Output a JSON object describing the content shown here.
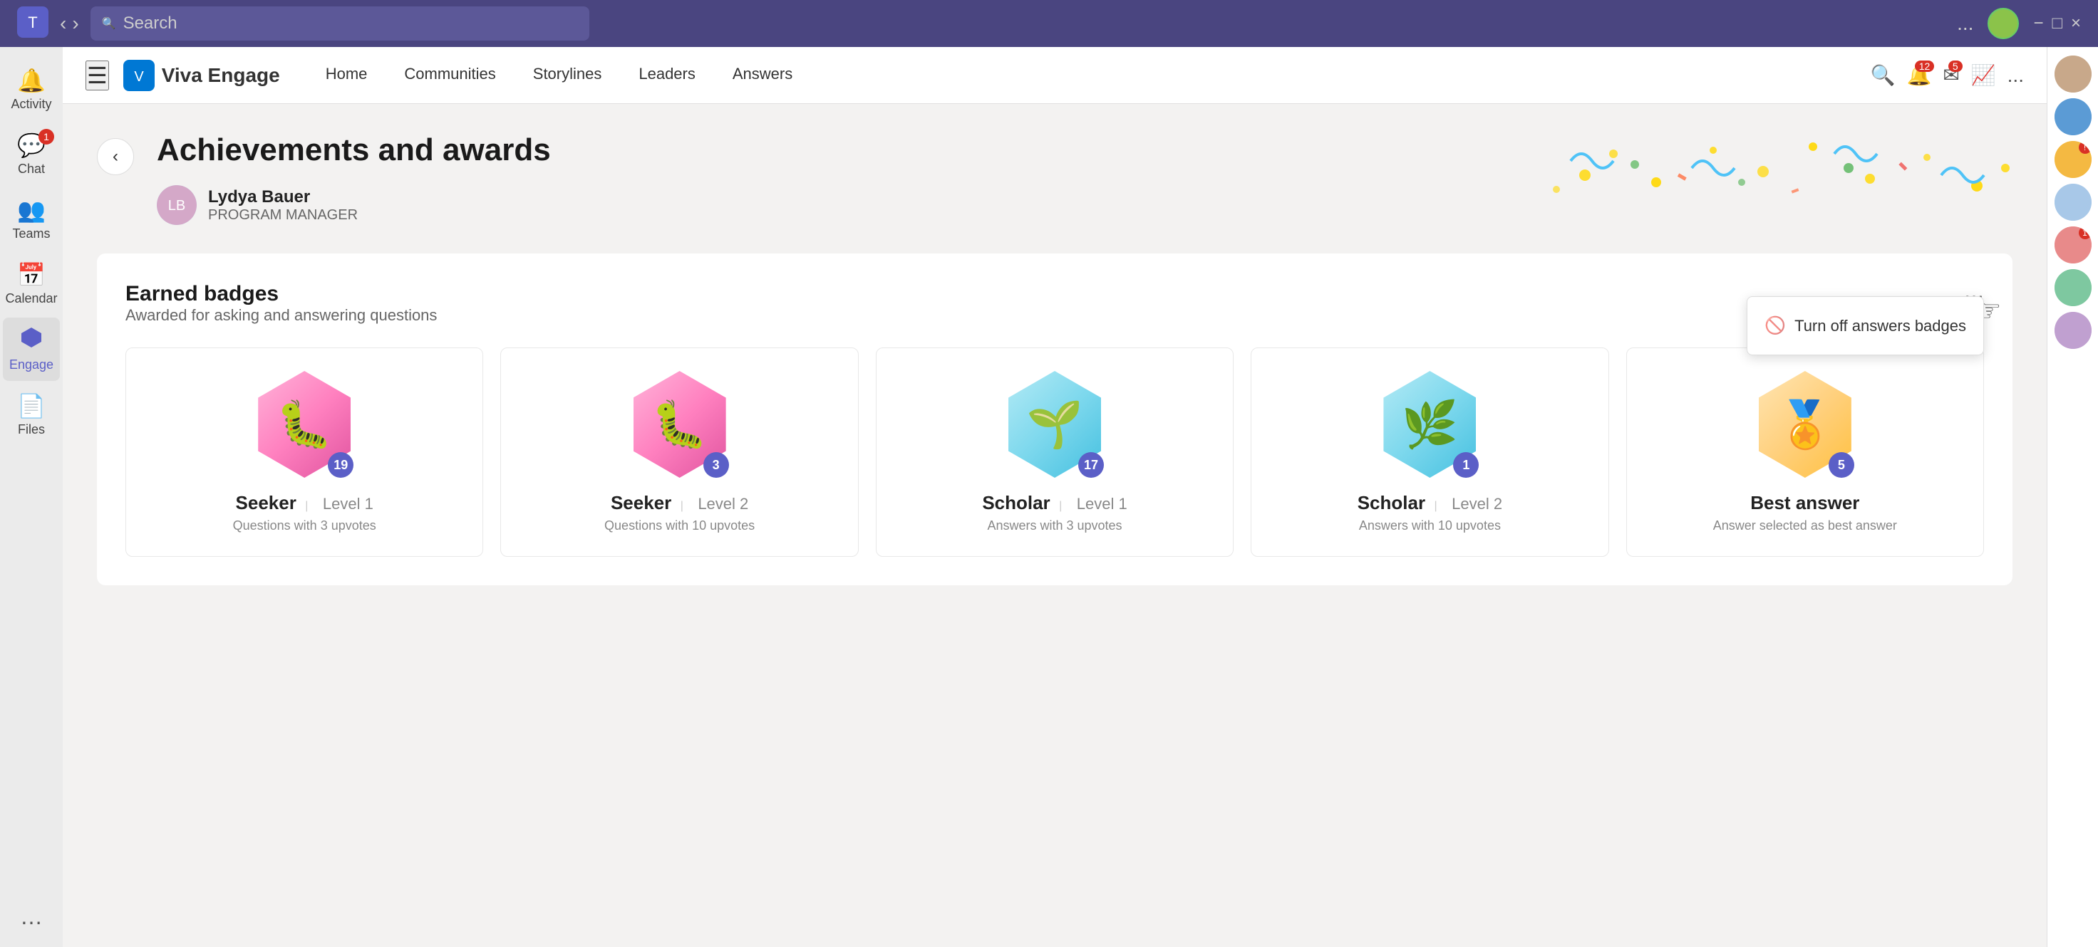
{
  "titlebar": {
    "search_placeholder": "Search",
    "more_label": "..."
  },
  "sidebar": {
    "items": [
      {
        "label": "Activity",
        "icon": "🔔",
        "badge": null,
        "active": false
      },
      {
        "label": "Chat",
        "icon": "💬",
        "badge": "1",
        "active": false
      },
      {
        "label": "Teams",
        "icon": "👥",
        "badge": null,
        "active": false
      },
      {
        "label": "Calendar",
        "icon": "📅",
        "badge": null,
        "active": false
      },
      {
        "label": "Engage",
        "icon": "◆",
        "badge": null,
        "active": true
      },
      {
        "label": "Files",
        "icon": "📄",
        "badge": null,
        "active": false
      }
    ],
    "more_label": "..."
  },
  "engage_nav": {
    "title": "Viva Engage",
    "links": [
      {
        "label": "Home"
      },
      {
        "label": "Communities"
      },
      {
        "label": "Storylines"
      },
      {
        "label": "Leaders"
      },
      {
        "label": "Answers"
      }
    ],
    "actions": {
      "search_icon": "🔍",
      "bell_icon": "🔔",
      "bell_badge": "12",
      "message_icon": "✉",
      "message_badge": "5",
      "chart_icon": "📈",
      "more_icon": "..."
    }
  },
  "page": {
    "back_icon": "‹",
    "title": "Achievements and awards",
    "user": {
      "name": "Lydya Bauer",
      "role": "PROGRAM MANAGER"
    }
  },
  "badges_section": {
    "title": "Earned badges",
    "subtitle": "Awarded for asking and answering questions",
    "more_icon": "⋯",
    "badges": [
      {
        "name": "Seeker",
        "level": "Level 1",
        "desc": "Questions with 3 upvotes",
        "count": "19",
        "color_class": "seeker1-bg",
        "emoji": "🐛"
      },
      {
        "name": "Seeker",
        "level": "Level 2",
        "desc": "Questions with 10 upvotes",
        "count": "3",
        "color_class": "seeker2-bg",
        "emoji": "🐛"
      },
      {
        "name": "Scholar",
        "level": "Level 1",
        "desc": "Answers with 3 upvotes",
        "count": "17",
        "color_class": "scholar1-bg",
        "emoji": "🌱"
      },
      {
        "name": "Scholar",
        "level": "Level 2",
        "desc": "Answers with 10 upvotes",
        "count": "1",
        "color_class": "scholar2-bg",
        "emoji": "🌿"
      },
      {
        "name": "Best answer",
        "level": "",
        "desc": "Answer selected as best answer",
        "count": "5",
        "color_class": "best-bg",
        "emoji": "🏅"
      }
    ]
  },
  "dropdown": {
    "items": [
      {
        "label": "Turn off answers badges",
        "icon": "🚫"
      }
    ]
  }
}
